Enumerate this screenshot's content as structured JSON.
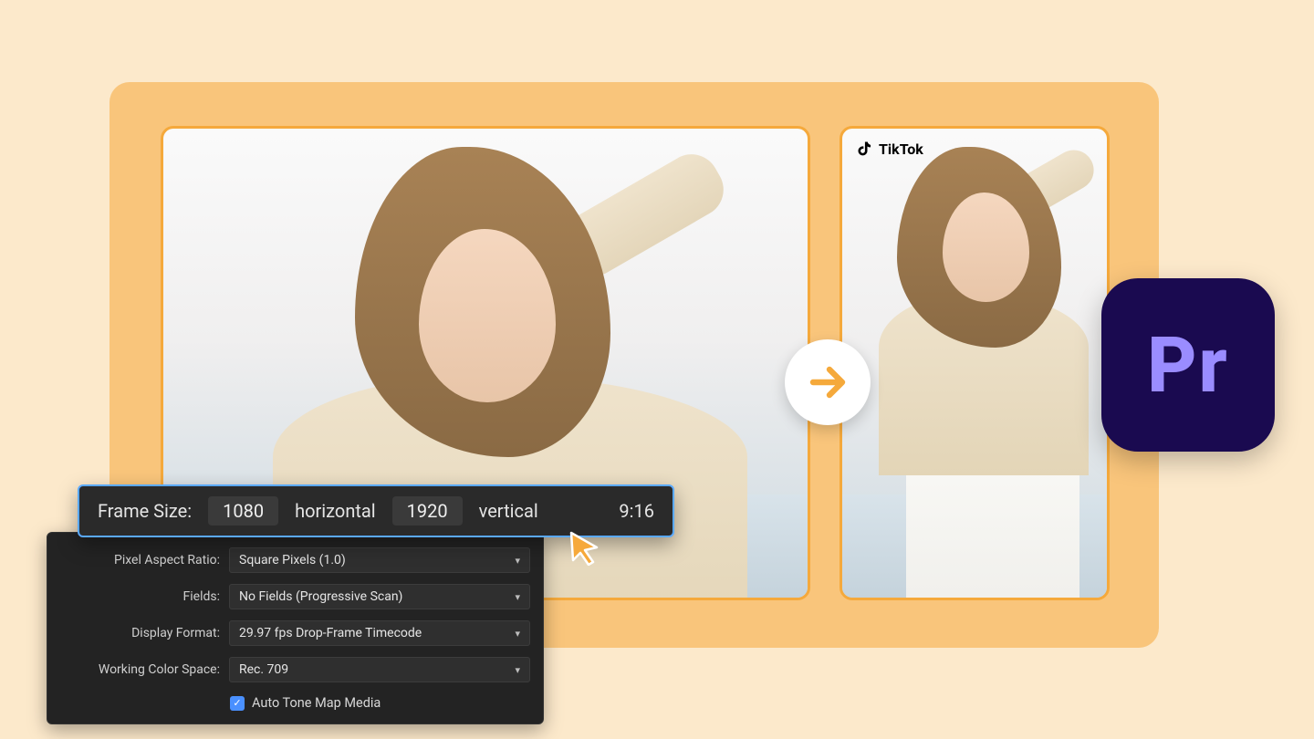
{
  "platform_badge": {
    "label": "TikTok"
  },
  "premiere_logo": {
    "text": "Pr"
  },
  "framesize": {
    "label": "Frame Size:",
    "width": "1080",
    "horizontal": "horizontal",
    "height": "1920",
    "vertical": "vertical",
    "ratio": "9:16"
  },
  "settings": {
    "pixel_aspect": {
      "label": "Pixel Aspect Ratio:",
      "value": "Square Pixels (1.0)"
    },
    "fields": {
      "label": "Fields:",
      "value": "No Fields (Progressive Scan)"
    },
    "display_format": {
      "label": "Display Format:",
      "value": "29.97 fps Drop-Frame Timecode"
    },
    "color_space": {
      "label": "Working Color Space:",
      "value": "Rec. 709"
    },
    "auto_tone": {
      "label": "Auto Tone Map Media",
      "checked": true
    }
  }
}
